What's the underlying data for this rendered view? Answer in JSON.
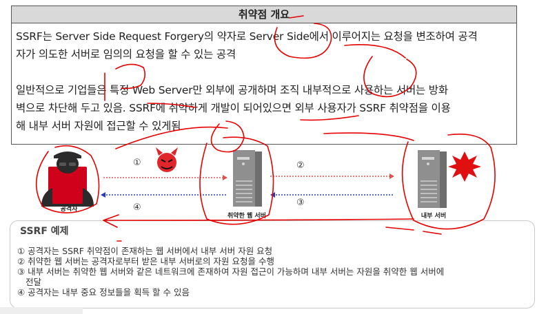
{
  "overview": {
    "title": "취약점 개요",
    "paragraph1_line1": "SSRF는 Server Side Request Forgery의 약자로 Server Side에서 이루어지는 요청을 변조하여 공격",
    "paragraph1_line2": "자가 의도한 서버로 임의의 요청을 할 수 있는 공격",
    "paragraph2_line1": "일반적으로 기업들은 특정 Web Server만 외부에 공개하며 조직 내부적으로 사용하는 서버는 방화",
    "paragraph2_line2": "벽으로 차단해 두고 있음. SSRF에 취약하게 개발이 되어있으면 외부 사용자가 SSRF 취약점을 이용",
    "paragraph2_line3": "해 내부 서버 자원에 접근할 수 있게됨"
  },
  "diagram": {
    "attacker_label": "공격자",
    "web_server_label": "취약한 웹 서버",
    "internal_server_label": "내부 서버",
    "step1": "①",
    "step2": "②",
    "step3": "③",
    "step4": "④"
  },
  "example": {
    "title": "SSRF 예제",
    "steps": [
      "① 공격자는 SSRF 취약점이 존재하는 웹 서버에서 내부 서버 자원 요청",
      "② 취약한 웹 서버는 공격자로부터 받은 내부 서버로의 자원 요청을 수행",
      "③ 내부 서버는 취약한 웹 서버와 같은 네트워크에 존재하여 자원 접근이 가능하며 내부 서버는 자원을 취약한 웹 서버에",
      "전달",
      "④ 공격자는 내부 중요 정보들을 획득 할 수 있음"
    ]
  },
  "colors": {
    "attacker_red": "#d0021b",
    "annotation_red": "#e60000",
    "request_arrow": "#e05050",
    "response_arrow": "#2a3bb8",
    "server_gray": "#8a8a8a"
  }
}
